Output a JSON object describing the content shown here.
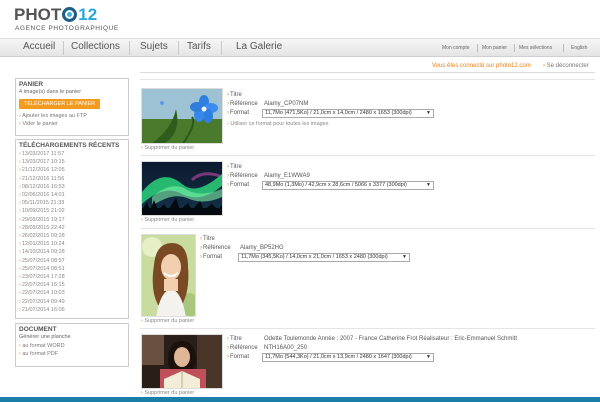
{
  "logo": {
    "text_before": "PHOT",
    "number": "12",
    "subtitle": "AGENCE PHOTOGRAPHIQUE"
  },
  "nav": {
    "items": [
      "Accueil",
      "Collections",
      "Sujets",
      "Tarifs",
      "La Galerie"
    ],
    "utility": [
      "Mon compte",
      "Mon panier",
      "Mes sélections",
      "English"
    ]
  },
  "account": {
    "connected_text": "Vous êtes connecté sur photo12.com",
    "disconnect_label": "Se déconnecter"
  },
  "panier": {
    "title": "PANIER",
    "count_text": "4 image(s) dans le panier",
    "download_button": "TÉLÉCHARGER LE PANIER",
    "ftp_link": "Ajouter les images au FTP",
    "empty_link": "Vider le panier"
  },
  "downloads": {
    "title": "TÉLÉCHARGEMENTS RÉCENTS",
    "items": [
      "13/03/2017 11:57",
      "13/03/2017 10:15",
      "21/12/2016 12:05",
      "21/12/2016 11:56",
      "08/12/2016 16:53",
      "02/06/2016 14:01",
      "05/11/2015 21:33",
      "10/09/2015 21:02",
      "29/03/2015 19:17",
      "28/03/2015 22:42",
      "26/02/2015 09:28",
      "12/01/2015 10:24",
      "14/10/2014 09:28",
      "25/07/2014 08:57",
      "25/07/2014 08:51",
      "23/07/2014 17:28",
      "22/07/2014 16:15",
      "22/07/2014 10:03",
      "22/07/2014 09:49",
      "21/07/2014 16:06"
    ]
  },
  "document": {
    "title": "DOCUMENT",
    "subtitle": "Générer une planche",
    "word_link": "au format WORD",
    "pdf_link": "au format PDF"
  },
  "labels": {
    "titre": "Titre",
    "reference": "Référence",
    "format": "Format",
    "remove": "Supprimer du panier",
    "use_for_all": "Utiliser ce format pour toutes les images"
  },
  "items": [
    {
      "title": "",
      "reference": "Alamy_CP07NM",
      "format": "11,7Mo (471,5Ko) / 21,0cm x 14,0cm / 2480 x 1653 (300dpi)"
    },
    {
      "title": "",
      "reference": "Alamy_E1WWA9",
      "format": "48,9Mo (1,3Mo) / 42,9cm x 28,6cm / 5066 x 3377 (300dpi)"
    },
    {
      "title": "",
      "reference": "Alamy_BP52HG",
      "format": "11,7Mo (345,5Ko) / 14,0cm x 21,0cm / 1653 x 2480 (300dpi)"
    },
    {
      "title": "Odette Toulemonde Année : 2007 - France Catherine Frot Réalisateur : Eric-Emmanuel Schmitt",
      "reference": "NTH16A00_250",
      "format": "11,7Mo (544,3Ko) / 21,0cm x 13,9cm / 2480 x 1647 (300dpi)"
    }
  ],
  "colors": {
    "accent": "#f29b1f",
    "brand_blue": "#29a8d8",
    "bottom_bar": "#1a7fa8"
  }
}
